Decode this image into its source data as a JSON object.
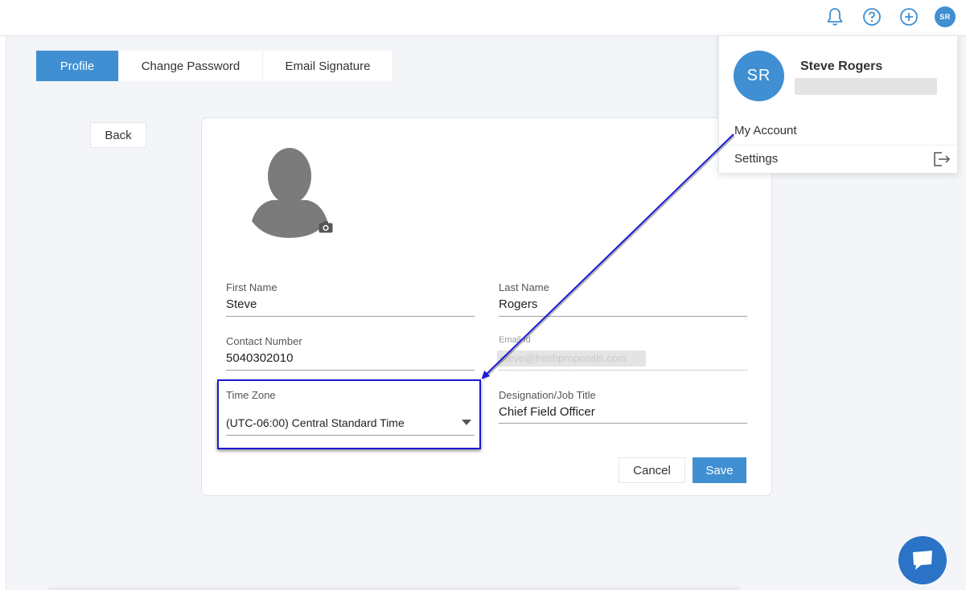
{
  "header": {
    "icons": [
      "bell-icon",
      "help-icon",
      "add-icon"
    ],
    "avatar_initials": "SR"
  },
  "tabs": [
    {
      "label": "Profile",
      "active": true
    },
    {
      "label": "Change Password",
      "active": false
    },
    {
      "label": "Email Signature",
      "active": false
    }
  ],
  "back_label": "Back",
  "form": {
    "first_name": {
      "label": "First Name",
      "value": "Steve"
    },
    "last_name": {
      "label": "Last Name",
      "value": "Rogers"
    },
    "contact_number": {
      "label": "Contact Number",
      "value": "5040302010"
    },
    "email": {
      "label": "Email Id",
      "value": "steve@freshproposals.com"
    },
    "time_zone": {
      "label": "Time Zone",
      "value": "(UTC-06:00) Central Standard Time"
    },
    "designation": {
      "label": "Designation/Job Title",
      "value": "Chief Field Officer"
    }
  },
  "buttons": {
    "cancel": "Cancel",
    "save": "Save"
  },
  "user_menu": {
    "initials": "SR",
    "name": "Steve Rogers",
    "items": [
      "My Account",
      "Settings"
    ]
  },
  "colors": {
    "accent": "#3f8fd2",
    "annotation": "#1a1ad0",
    "chat": "#2a73c7"
  }
}
